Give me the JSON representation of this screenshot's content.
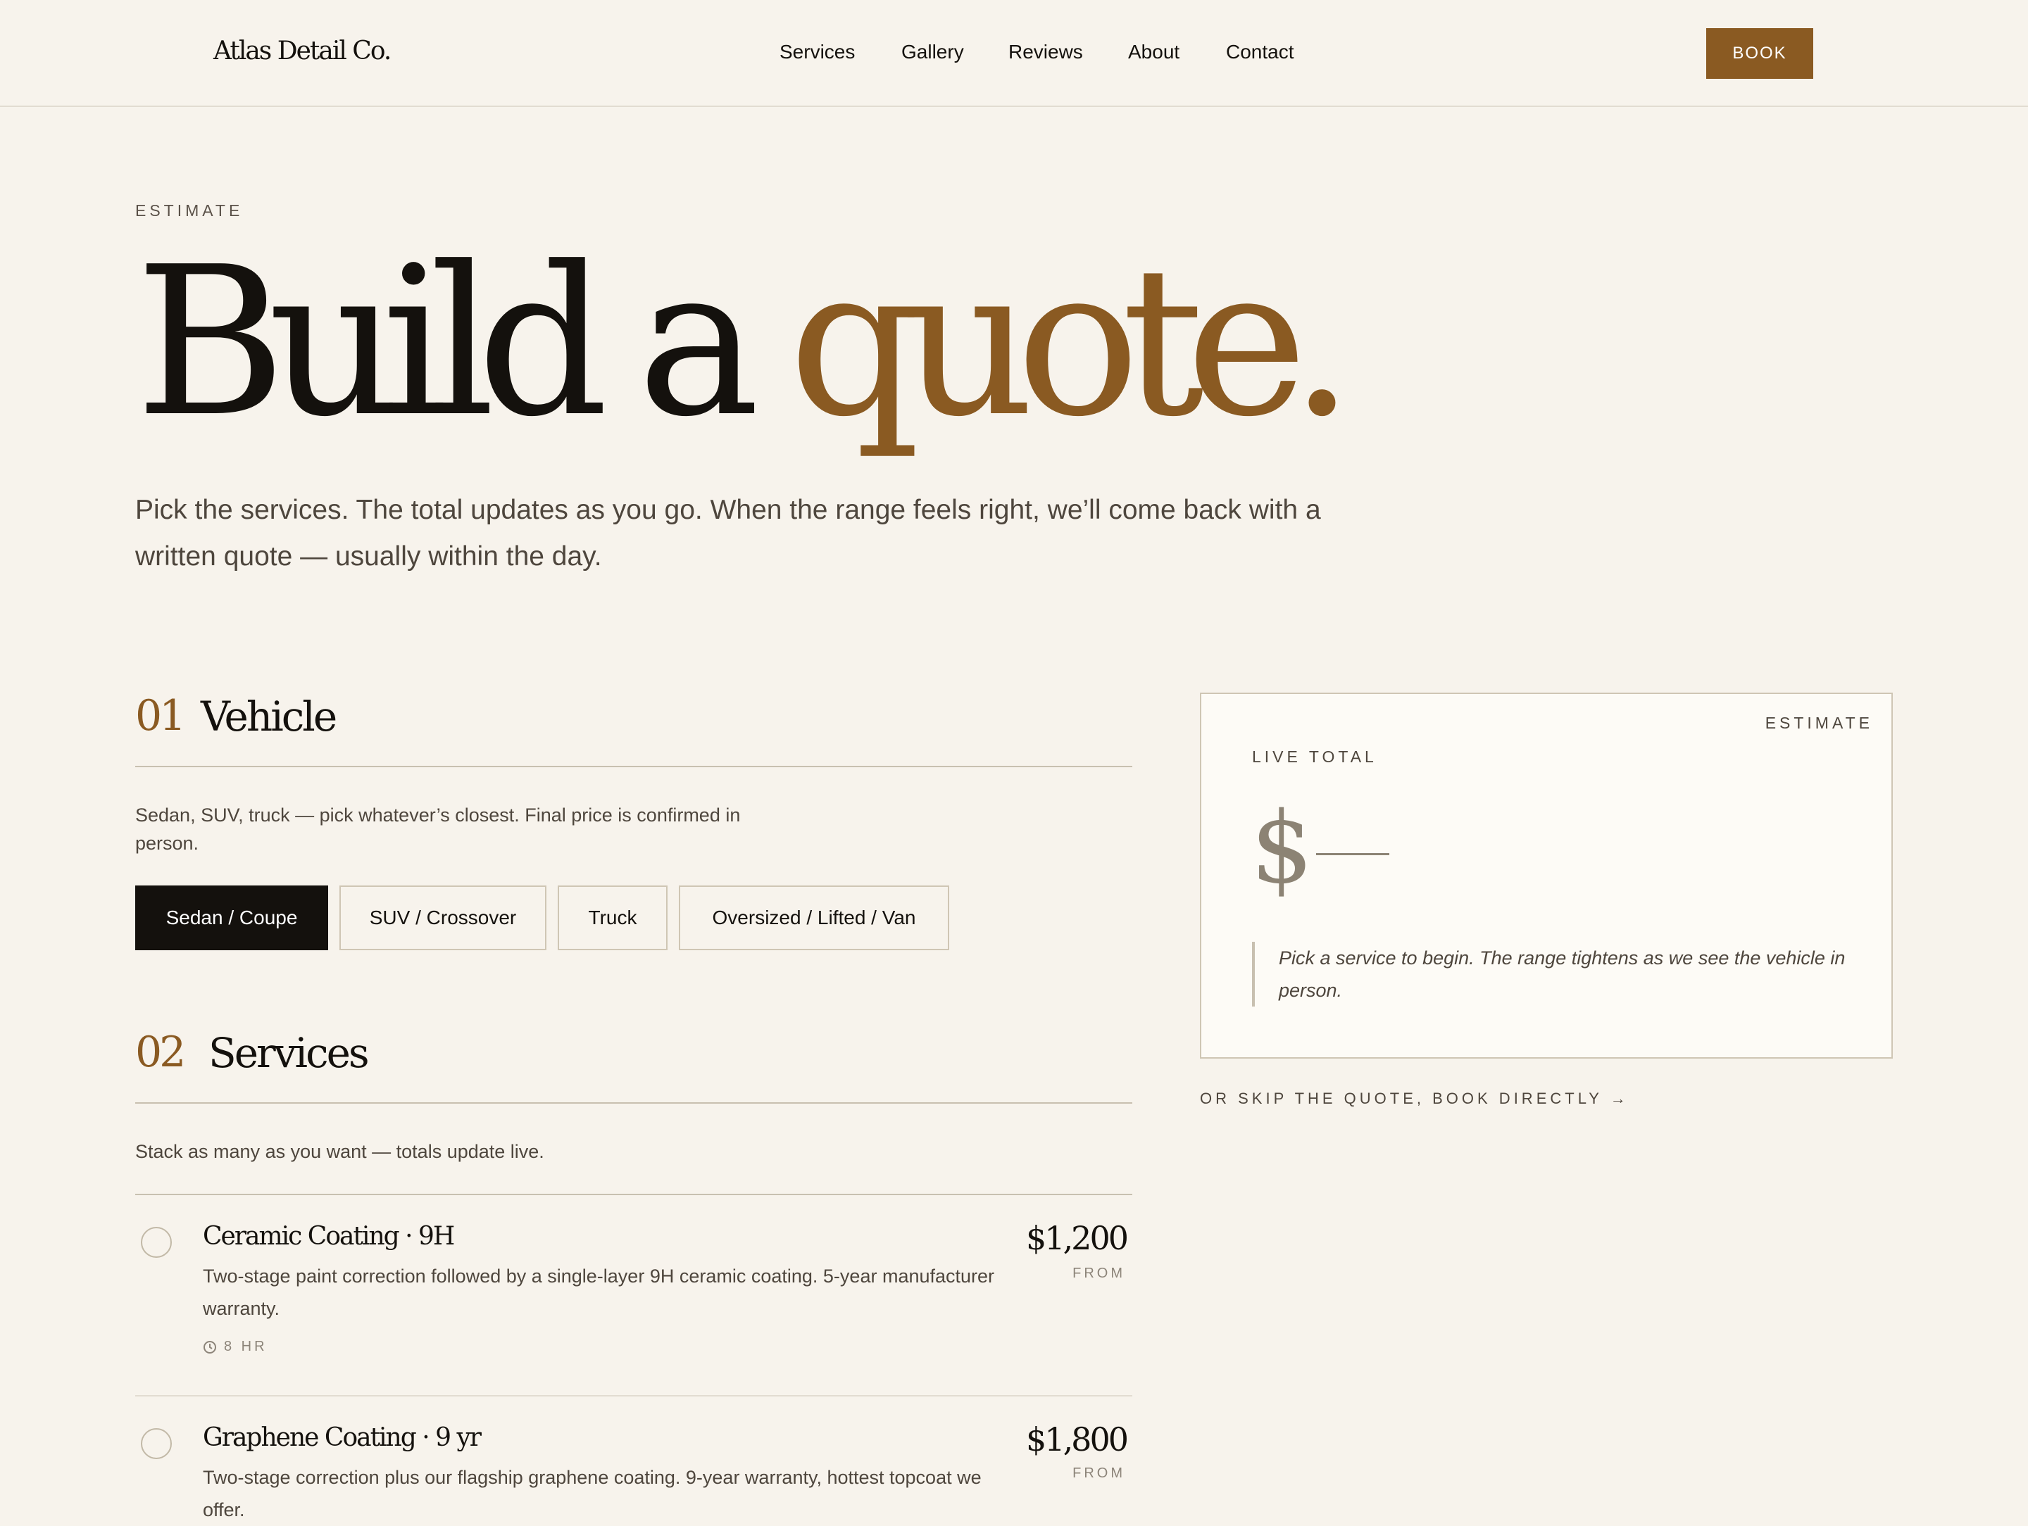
{
  "brand": {
    "logo": "Atlas Detail Co."
  },
  "nav": {
    "items": [
      "Services",
      "Gallery",
      "Reviews",
      "About",
      "Contact"
    ],
    "book_label": "BOOK"
  },
  "hero": {
    "eyebrow": "ESTIMATE",
    "headline_main": "Build a ",
    "headline_accent": "quote.",
    "lede": "Pick the services. The total updates as you go. When the range feels right, we’ll come back with a written quote — usually within the day."
  },
  "vehicle": {
    "number": "01",
    "title": "Vehicle",
    "description": "Sedan, SUV, truck — pick whatever’s closest. Final price is confirmed in person.",
    "options": [
      "Sedan / Coupe",
      "SUV / Crossover",
      "Truck",
      "Oversized / Lifted / Van"
    ],
    "selected": "Sedan / Coupe"
  },
  "services": {
    "number": "02",
    "title": "Services",
    "description": "Stack as many as you want — totals update live.",
    "items": [
      {
        "name": "Ceramic Coating · 9H",
        "description": "Two-stage paint correction followed by a single-layer 9H ceramic coating. 5-year manufacturer warranty.",
        "price": "$1,200",
        "price_note": "FROM",
        "duration": "8 HR"
      },
      {
        "name": "Graphene Coating · 9 yr",
        "description": "Two-stage correction plus our flagship graphene coating. 9-year warranty, hottest topcoat we offer.",
        "price": "$1,800",
        "price_note": "FROM"
      }
    ]
  },
  "estimate": {
    "tag": "ESTIMATE",
    "label": "LIVE TOTAL",
    "total": "$",
    "note": "Pick a service to begin. The range tightens as we see the vehicle in person."
  },
  "skip_link": "OR SKIP THE QUOTE, BOOK DIRECTLY →",
  "colors": {
    "accent": "#8a5a22",
    "background": "#f7f3ec",
    "ink": "#14110d",
    "rule": "#c8c0b0"
  }
}
